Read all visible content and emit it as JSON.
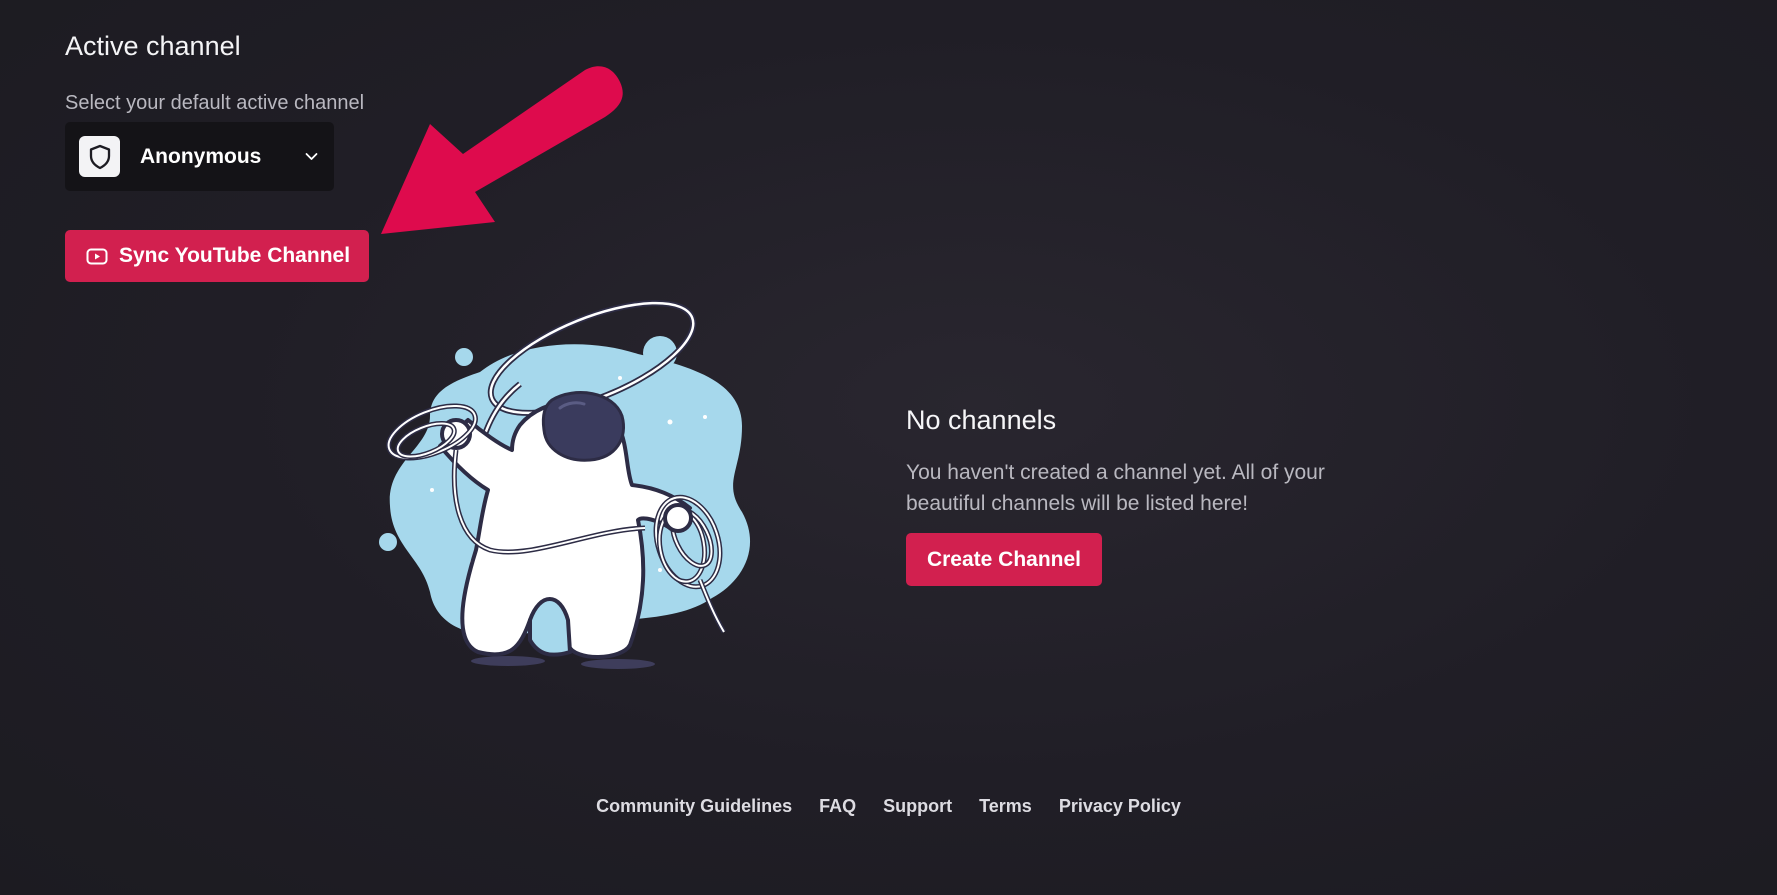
{
  "active_channel": {
    "title": "Active channel",
    "subtitle": "Select your default active channel",
    "selected": "Anonymous",
    "avatar_icon": "shield-icon",
    "dropdown_icon": "chevron-down-icon"
  },
  "sync_button": {
    "label": "Sync YouTube Channel",
    "icon": "youtube-icon"
  },
  "empty_state": {
    "illustration": "astronaut-with-lasso",
    "title": "No channels",
    "description": "You haven't created a channel yet. All of your beautiful channels will be listed here!",
    "button_label": "Create Channel"
  },
  "footer": {
    "links": [
      {
        "label": "Community Guidelines"
      },
      {
        "label": "FAQ"
      },
      {
        "label": "Support"
      },
      {
        "label": "Terms"
      },
      {
        "label": "Privacy Policy"
      }
    ]
  },
  "colors": {
    "accent": "#d2204f",
    "annotation_arrow": "#de0b4d",
    "background": "#201e26",
    "select_background": "#141317"
  }
}
